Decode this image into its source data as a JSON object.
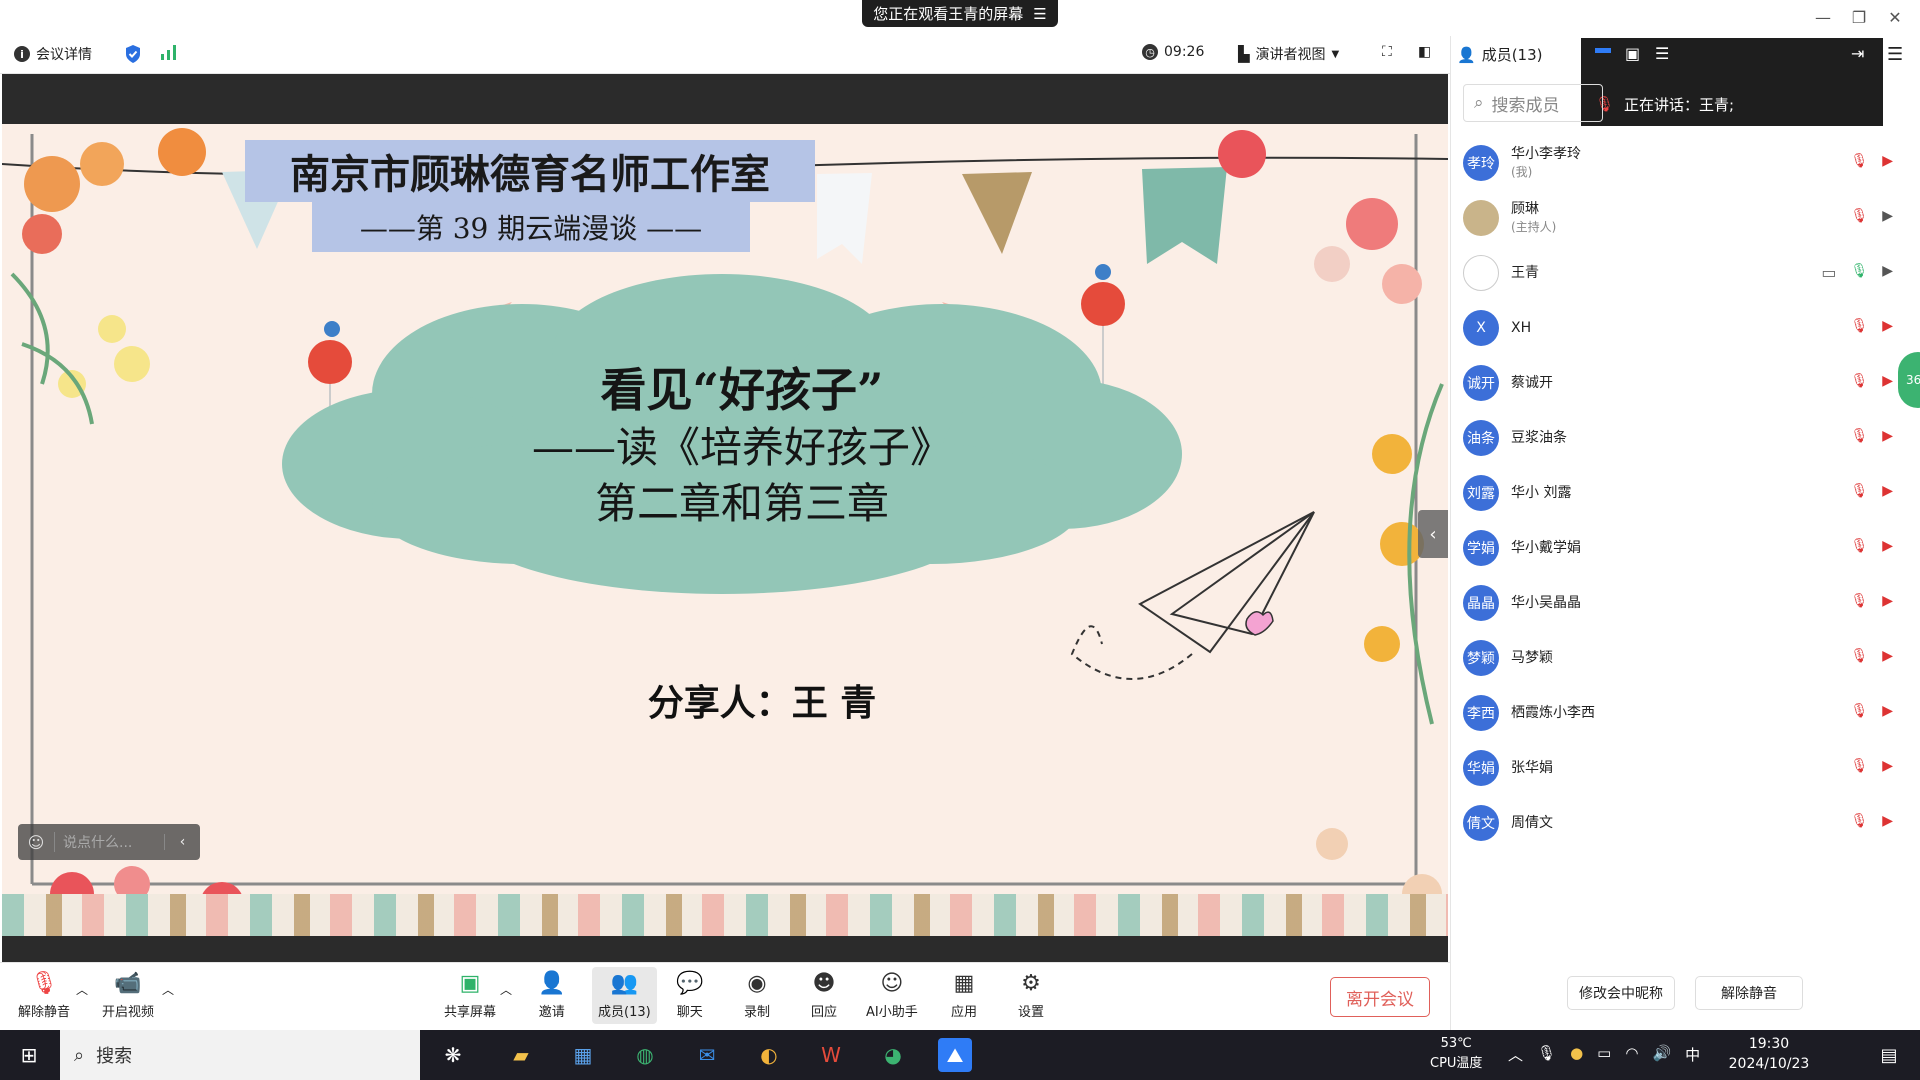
{
  "banner": {
    "text": "您正在观看王青的屏幕"
  },
  "toolbar": {
    "meeting_details": "会议详情",
    "timer": "09:26",
    "view_mode": "演讲者视图",
    "members": "成员(13)"
  },
  "slide": {
    "title": "南京市顾琳德育名师工作室",
    "subtitle": "——第 39 期云端漫谈 ——",
    "topic_line1": "看见“好孩子”",
    "topic_line2": "——读《培养好孩子》",
    "topic_line3": "第二章和第三章",
    "presenter": "分享人：王 青"
  },
  "chat_input": {
    "placeholder": "说点什么..."
  },
  "panel": {
    "search_placeholder": "搜索成员",
    "speaking": "正在讲话：王青;",
    "members": [
      {
        "avatar": "孝玲",
        "name": "华小李孝玲",
        "role": "(我)"
      },
      {
        "avatar": "",
        "name": "顾琳",
        "role": "(主持人)"
      },
      {
        "avatar": "",
        "name": "王青",
        "role": ""
      },
      {
        "avatar": "X",
        "name": "XH",
        "role": ""
      },
      {
        "avatar": "诚开",
        "name": "蔡诚开",
        "role": ""
      },
      {
        "avatar": "油条",
        "name": "豆浆油条",
        "role": ""
      },
      {
        "avatar": "刘露",
        "name": "华小 刘露",
        "role": ""
      },
      {
        "avatar": "学娟",
        "name": "华小戴学娟",
        "role": ""
      },
      {
        "avatar": "晶晶",
        "name": "华小吴晶晶",
        "role": ""
      },
      {
        "avatar": "梦颖",
        "name": "马梦颖",
        "role": ""
      },
      {
        "avatar": "李西",
        "name": "栖霞炼小李西",
        "role": ""
      },
      {
        "avatar": "华娟",
        "name": "张华娟",
        "role": ""
      },
      {
        "avatar": "倩文",
        "name": "周倩文",
        "role": ""
      }
    ],
    "rename_button": "修改会中昵称",
    "unmute_button": "解除静音",
    "side_badge": "36"
  },
  "bottombar": {
    "unmute": "解除静音",
    "start_video": "开启视频",
    "share_screen": "共享屏幕",
    "invite": "邀请",
    "members": "成员(13)",
    "chat": "聊天",
    "record": "录制",
    "replay": "回应",
    "ai_assistant": "AI小助手",
    "apps": "应用",
    "settings": "设置",
    "leave": "离开会议"
  },
  "taskbar": {
    "search": "搜索",
    "temp": "53℃",
    "cpu": "CPU温度",
    "ime": "中",
    "time": "19:30",
    "date": "2024/10/23"
  },
  "colors": {
    "accent_blue": "#3c6fd8",
    "cloud_green": "#93c6b7",
    "title_band": "#b5c4e6",
    "leave_red": "#e0605a"
  }
}
